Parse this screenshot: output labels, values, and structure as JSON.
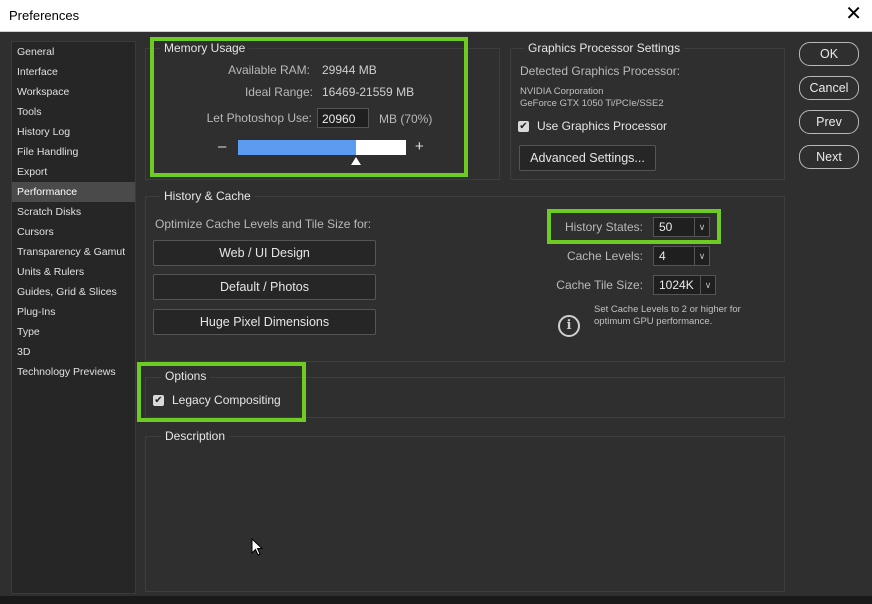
{
  "window": {
    "title": "Preferences",
    "close_icon": "close-icon"
  },
  "sidebar": {
    "items": [
      {
        "label": "General"
      },
      {
        "label": "Interface"
      },
      {
        "label": "Workspace"
      },
      {
        "label": "Tools"
      },
      {
        "label": "History Log"
      },
      {
        "label": "File Handling"
      },
      {
        "label": "Export"
      },
      {
        "label": "Performance",
        "active": true
      },
      {
        "label": "Scratch Disks"
      },
      {
        "label": "Cursors"
      },
      {
        "label": "Transparency & Gamut"
      },
      {
        "label": "Units & Rulers"
      },
      {
        "label": "Guides, Grid & Slices"
      },
      {
        "label": "Plug-Ins"
      },
      {
        "label": "Type"
      },
      {
        "label": "3D"
      },
      {
        "label": "Technology Previews"
      }
    ]
  },
  "memory": {
    "legend": "Memory Usage",
    "available_label": "Available RAM:",
    "available_value": "29944 MB",
    "ideal_label": "Ideal Range:",
    "ideal_value": "16469-21559 MB",
    "let_label": "Let Photoshop Use:",
    "let_value": "20960",
    "let_unit": "MB (70%)",
    "minus": "–",
    "plus": "+",
    "slider_fraction": 0.7
  },
  "gpu": {
    "legend": "Graphics Processor Settings",
    "detected_label": "Detected Graphics Processor:",
    "vendor": "NVIDIA Corporation",
    "model": "GeForce GTX 1050 Ti/PCIe/SSE2",
    "use_label": "Use Graphics Processor",
    "use_checked": true,
    "advanced_button": "Advanced Settings..."
  },
  "history_cache": {
    "legend": "History & Cache",
    "optimize_label": "Optimize Cache Levels and Tile Size for:",
    "buttons": [
      "Web / UI Design",
      "Default / Photos",
      "Huge Pixel Dimensions"
    ],
    "history_states_label": "History States:",
    "history_states_value": "50",
    "cache_levels_label": "Cache Levels:",
    "cache_levels_value": "4",
    "tile_size_label": "Cache Tile Size:",
    "tile_size_value": "1024K",
    "info_line1": "Set Cache Levels to 2 or higher for",
    "info_line2": "optimum GPU performance."
  },
  "options": {
    "legend": "Options",
    "legacy_label": "Legacy Compositing",
    "legacy_checked": true
  },
  "description": {
    "legend": "Description"
  },
  "actions": {
    "ok": "OK",
    "cancel": "Cancel",
    "prev": "Prev",
    "next": "Next"
  },
  "colors": {
    "highlight": "#6ecb21",
    "slider_fill": "#5b9cf0",
    "background": "#2f2f2f"
  }
}
